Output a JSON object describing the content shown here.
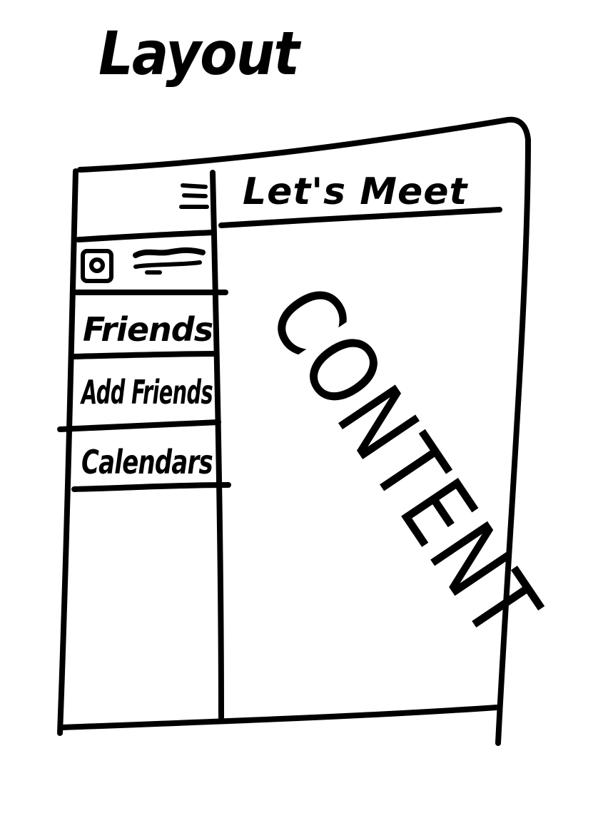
{
  "title": "Layout",
  "header": {
    "title": "Let's Meet",
    "menu_icon": "hamburger-menu-icon"
  },
  "sidebar": {
    "profile_icon": "avatar-icon",
    "items": [
      {
        "label": "Friends"
      },
      {
        "label": "Add Friends"
      },
      {
        "label": "Calendars"
      }
    ]
  },
  "main": {
    "placeholder": "CONTENT"
  }
}
